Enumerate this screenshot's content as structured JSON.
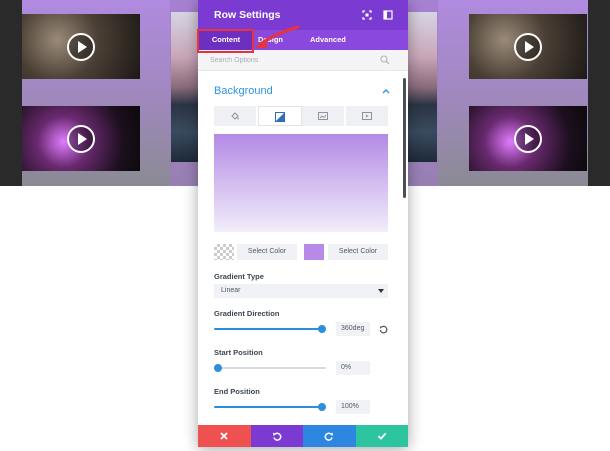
{
  "modal": {
    "title": "Row Settings",
    "tabs": [
      {
        "label": "Content",
        "active": true
      },
      {
        "label": "Design",
        "active": false
      },
      {
        "label": "Advanced",
        "active": false
      }
    ],
    "search": {
      "placeholder": "Search Options"
    },
    "section": {
      "title": "Background",
      "expanded": true
    },
    "background_tabs": [
      {
        "icon": "paint-bucket-icon",
        "selected": false
      },
      {
        "icon": "gradient-icon",
        "selected": true
      },
      {
        "icon": "image-icon",
        "selected": false
      },
      {
        "icon": "video-icon",
        "selected": false
      }
    ],
    "gradient_preview": {
      "start_color": "#b38ae6",
      "end_color": "#f2eefa"
    },
    "colors": [
      {
        "swatch": "transparent",
        "label": "Select Color"
      },
      {
        "swatch": "#b88ae8",
        "label": "Select Color"
      }
    ],
    "gradient_type": {
      "label": "Gradient Type",
      "value": "Linear"
    },
    "gradient_direction": {
      "label": "Gradient Direction",
      "value": "360deg",
      "fraction": 1.0
    },
    "start_position": {
      "label": "Start Position",
      "value": "0%",
      "fraction": 0.0
    },
    "end_position": {
      "label": "End Position",
      "value": "100%",
      "fraction": 1.0
    },
    "footer": [
      "close-icon",
      "undo-icon",
      "redo-icon",
      "check-icon"
    ]
  },
  "colors": {
    "title_bar": "#7b3bd2",
    "tab_bar": "#8a48df",
    "accent_blue": "#2e95e0",
    "cancel": "#ef5050",
    "undo": "#7b3bd2",
    "redo": "#2d86e0",
    "save": "#2cc5a0",
    "annotation_red": "#e8323c"
  }
}
